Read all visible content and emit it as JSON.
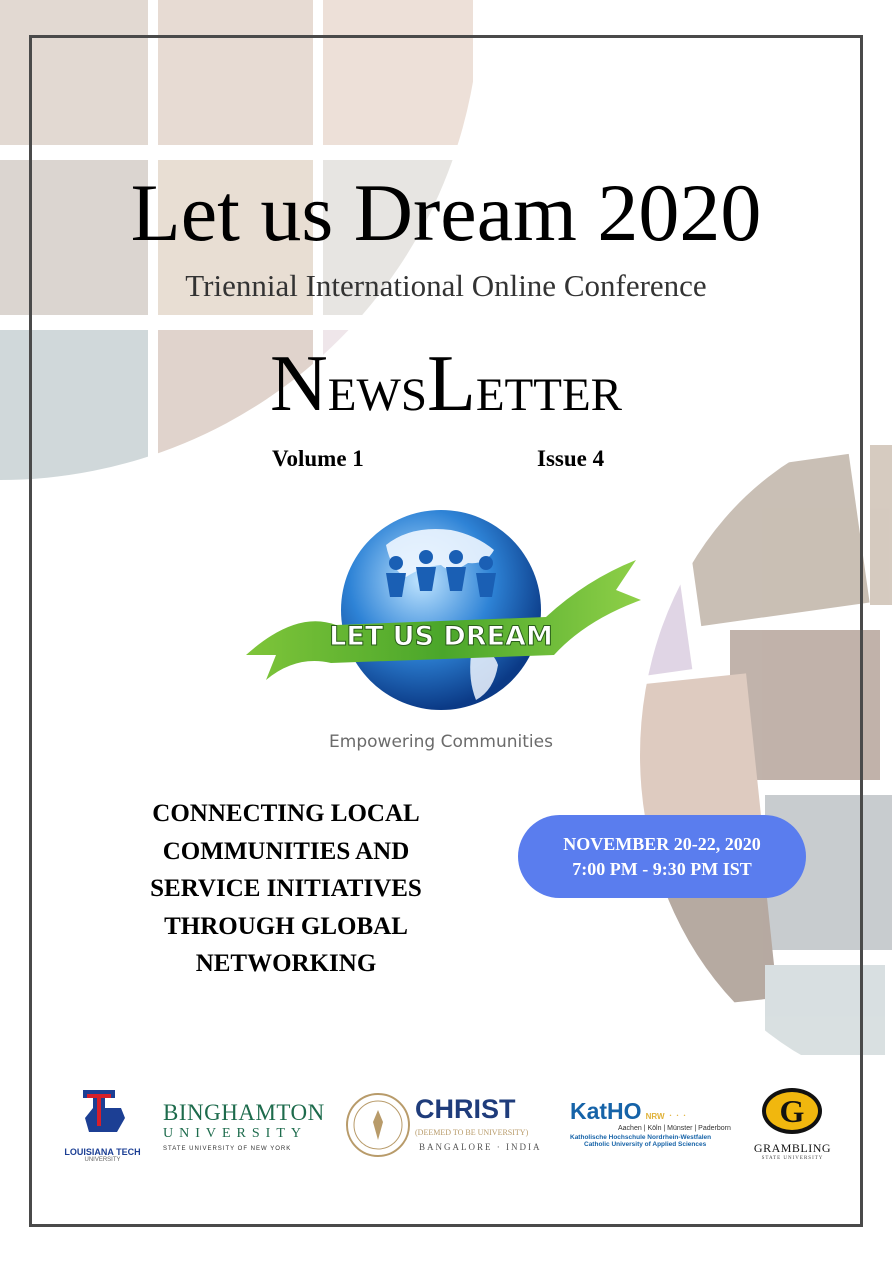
{
  "header": {
    "title": "Let us Dream 2020",
    "subtitle": "Triennial International Online Conference",
    "newsletter": {
      "n": "N",
      "ews": "EWS",
      "l": "L",
      "etter": "ETTER"
    },
    "volume": "Volume 1",
    "issue": "Issue 4"
  },
  "logo": {
    "banner_text": "LET US DREAM",
    "tagline": "Empowering Communities"
  },
  "headline": {
    "lines": [
      "CONNECTING LOCAL",
      "COMMUNITIES AND",
      "SERVICE INITIATIVES",
      "THROUGH GLOBAL",
      "NETWORKING"
    ]
  },
  "event": {
    "dates": "NOVEMBER 20-22, 2020",
    "time": "7:00 PM - 9:30 PM IST"
  },
  "partners": {
    "louisiana": {
      "name": "LOUISIANA TECH",
      "sub": "UNIVERSITY"
    },
    "binghamton": {
      "name": "BINGHAMTON",
      "university": "UNIVERSITY",
      "sub": "STATE UNIVERSITY OF NEW YORK"
    },
    "christ": {
      "name": "CHRIST",
      "deemed": "(DEEMED TO BE UNIVERSITY)",
      "place": "BANGALORE · INDIA"
    },
    "katho": {
      "name": "KatHO",
      "nrw": "NRW",
      "cities": "Aachen | Köln | Münster | Paderborn",
      "de": "Katholische Hochschule Nordrhein-Westfalen",
      "en": "Catholic University of Applied Sciences"
    },
    "grambling": {
      "letter": "G",
      "name": "GRAMBLING",
      "sub": "STATE UNIVERSITY"
    }
  },
  "colors": {
    "pill": "#5a7dee",
    "frame": "#4a4a4a",
    "louisiana_red": "#d71f2b",
    "louisiana_blue": "#1c3f94",
    "binghamton_green": "#1d6b4c",
    "christ_blue": "#1f3c7b",
    "katho_blue": "#1663a8",
    "grambling_gold": "#f1b70e"
  }
}
